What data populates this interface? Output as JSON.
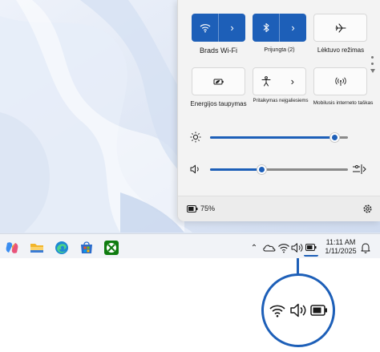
{
  "quick_settings": {
    "tiles": [
      {
        "id": "wifi",
        "label": "Brads Wi-Fi",
        "state": "on",
        "icon": "wifi-icon",
        "has_chevron": true
      },
      {
        "id": "bluetooth",
        "label": "Prijungta (2)",
        "state": "on",
        "icon": "bluetooth-icon",
        "has_chevron": true
      },
      {
        "id": "airplane",
        "label": "Lėktuvo režimas",
        "state": "off",
        "icon": "airplane-icon",
        "has_chevron": false
      },
      {
        "id": "energy_saver",
        "label": "Energijos taupymas",
        "state": "off",
        "icon": "battery-leaf-icon",
        "has_chevron": false
      },
      {
        "id": "accessibility",
        "label": "Pritaikymas neįgaliesiems",
        "state": "off",
        "icon": "accessibility-icon",
        "has_chevron": true
      },
      {
        "id": "hotspot",
        "label": "Mobilusis interneto taškas",
        "state": "off",
        "icon": "hotspot-icon",
        "has_chevron": false
      }
    ],
    "brightness": {
      "icon": "sun-icon",
      "level": 0.9
    },
    "volume": {
      "icon": "speaker-icon",
      "level": 0.37
    },
    "battery_text": "75%",
    "battery_icon": "battery-icon",
    "settings_icon": "gear-icon"
  },
  "taskbar": {
    "apps": [
      "copilot-icon",
      "file-explorer-icon",
      "edge-icon",
      "store-icon",
      "xbox-icon"
    ],
    "tray_icons": [
      "chevron-up-icon",
      "onedrive-icon",
      "wifi-icon",
      "speaker-icon",
      "battery-icon",
      "bell-icon"
    ],
    "time": "11:11 AM",
    "date": "1/11/2025"
  },
  "callout_icons": [
    "wifi-icon",
    "speaker-icon",
    "battery-icon"
  ],
  "colors": {
    "accent": "#1d5fb8",
    "wallpaper": "#dfe7f4",
    "flyout_bg": "#f3f3f3",
    "taskbar_bg": "#f1f3f7"
  }
}
